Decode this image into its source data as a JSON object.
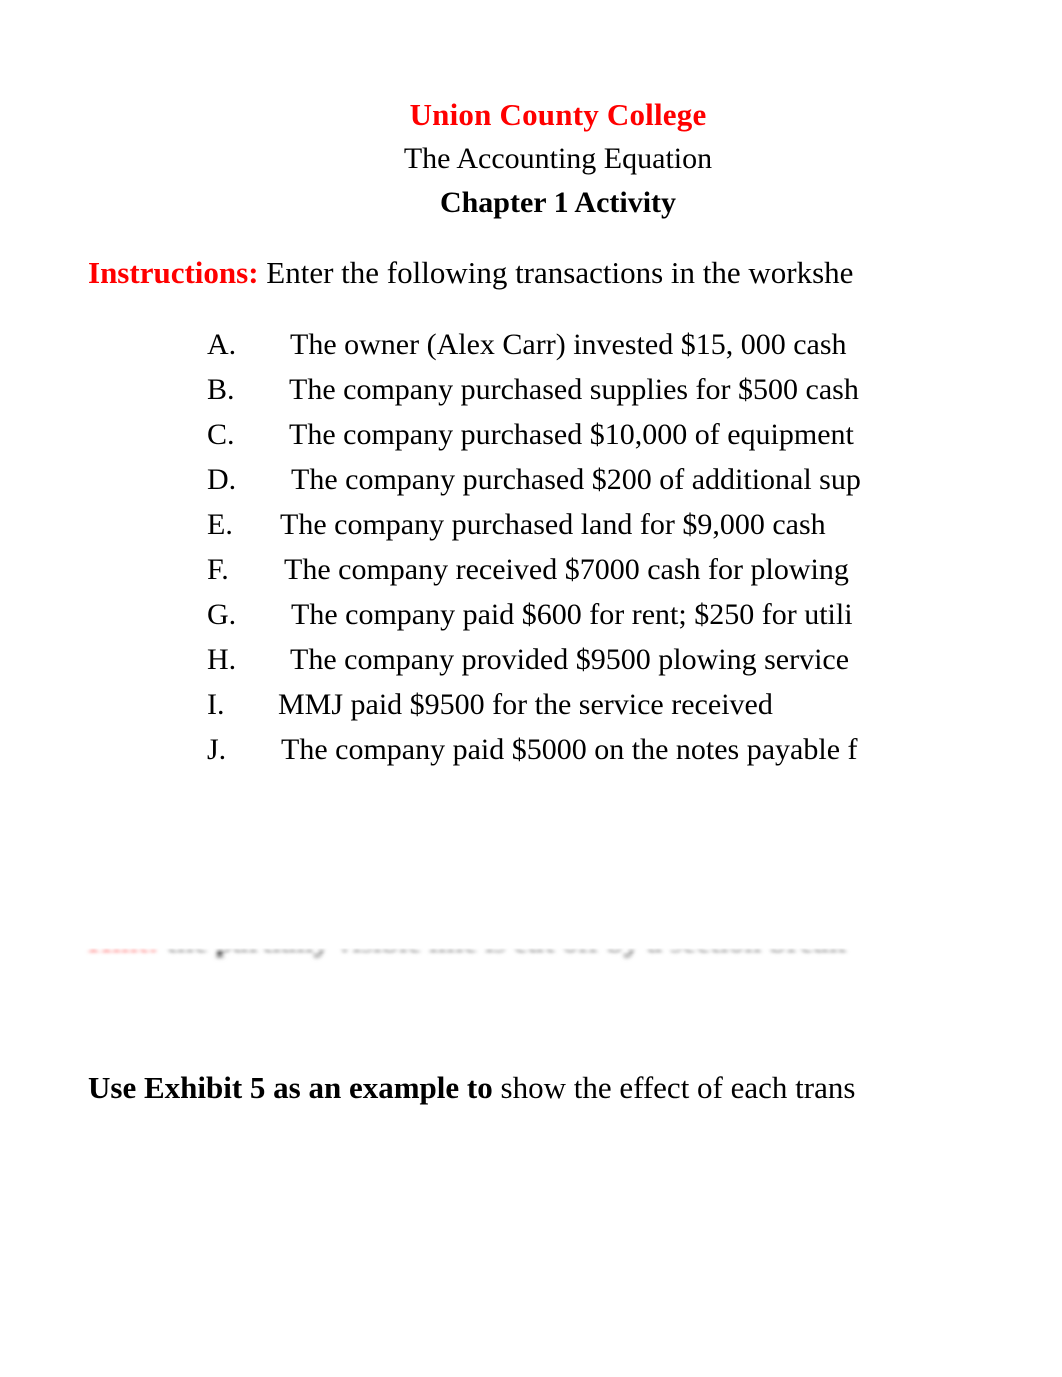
{
  "document": {
    "header": {
      "institution": "Union County College",
      "subject": "The Accounting Equation",
      "chapter": "Chapter 1 Activity",
      "institution_color": "#FF0000"
    },
    "instructions": {
      "label": "Instructions:",
      "text": " Enter the following transactions in the workshe",
      "label_color": "#FF0000"
    },
    "transactions": [
      {
        "marker": "A.",
        "text": "The owner (Alex Carr) invested $15, 000 cash"
      },
      {
        "marker": "B.",
        "text": "The company purchased supplies for $500 cash"
      },
      {
        "marker": "C.",
        "text": "The company purchased $10,000 of equipment"
      },
      {
        "marker": "D.",
        "text": "The company purchased $200 of additional sup"
      },
      {
        "marker": "E.",
        "text": "The company purchased land for $9,000 cash"
      },
      {
        "marker": "F.",
        "text": "The company received $7000 cash for plowing"
      },
      {
        "marker": "G.",
        "text": "The company paid $600 for rent; $250 for utili"
      },
      {
        "marker": "H.",
        "text": "The company provided $9500 plowing service"
      },
      {
        "marker": "I.",
        "text": "MMJ paid $9500 for the service received"
      },
      {
        "marker": "J.",
        "text": "The company paid $5000 on the notes payable f"
      }
    ],
    "partial_row": {
      "label": "Hint:",
      "text": " the partially visible line is cut off by a section break"
    },
    "footer": {
      "strong": "Use Exhibit 5 as an example to",
      "rest": " show the effect of each trans"
    }
  }
}
